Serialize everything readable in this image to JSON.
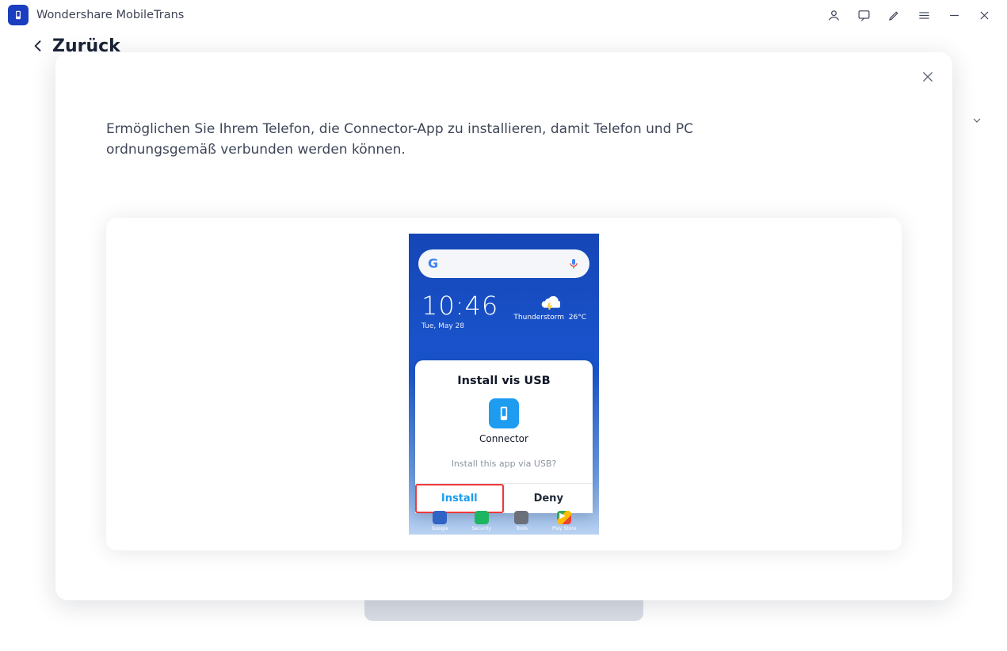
{
  "app": {
    "title": "Wondershare MobileTrans"
  },
  "header": {
    "back_label": "Zurück"
  },
  "modal": {
    "message": "Ermöglichen Sie Ihrem Telefon, die Connector-App zu installieren, damit Telefon und PC ordnungsgemäß verbunden werden können."
  },
  "phone": {
    "time": "10:46",
    "date": "Tue, May 28",
    "weather_label": "Thunderstorm",
    "weather_temp": "26°C",
    "popup": {
      "title": "Install vis USB",
      "app_name": "Connector",
      "question": "Install this app via USB?",
      "install_label": "Install",
      "deny_label": "Deny"
    },
    "dock": [
      "Google",
      "Security",
      "Tools",
      "Play Store"
    ]
  }
}
